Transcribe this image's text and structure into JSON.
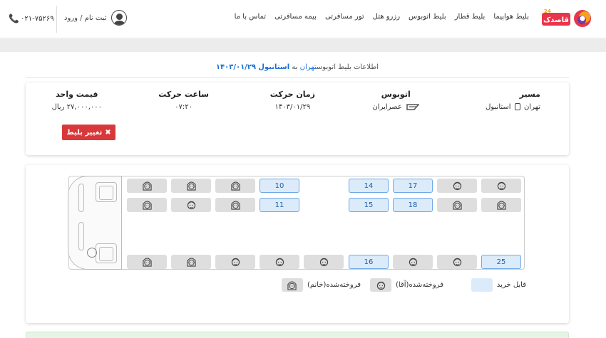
{
  "header": {
    "logo_text": "قاصدک",
    "logo_badge": "24",
    "nav": [
      "بلیط هواپیما",
      "بلیط قطار",
      "بلیط اتوبوس",
      "رزرو هتل",
      "تور مسافرتی",
      "بیمه مسافرتی",
      "تماس با ما"
    ],
    "login_label": "ثبت نام / ورود",
    "phone": "۰۲۱-۷۵۲۶۹"
  },
  "title": {
    "prefix": "اطلاعات بلیط اتوبوس",
    "from": "تهران",
    "mid": " به ",
    "to": "استانبول",
    "date": "۱۴۰۳/۰۱/۲۹"
  },
  "info": {
    "route_label": "مسیر",
    "route_from": "تهران",
    "route_to": "استانبول",
    "bus_label": "اتوبوس",
    "bus_company": "عصرایران",
    "date_label": "زمان حرکت",
    "date_value": "۱۴۰۳/۰۱/۲۹",
    "time_label": "ساعت حرکت",
    "time_value": "۰۷:۲۰",
    "price_label": "قیمت واحد",
    "price_value": "۲۷,۰۰۰,۰۰۰ ریال",
    "change_button": "تغییر بلیط"
  },
  "seats": {
    "row1": [
      "sold",
      "sold",
      "sold",
      "10",
      "",
      "14",
      "17",
      "sold",
      "sold"
    ],
    "row2": [
      "sold",
      "sold",
      "sold",
      "11",
      "",
      "15",
      "18",
      "sold",
      "sold"
    ],
    "row3": [
      "sold",
      "sold",
      "sold",
      "sold",
      "sold",
      "16",
      "sold",
      "sold",
      "25"
    ]
  },
  "legend": {
    "available": "قابل خرید",
    "sold_male": "فروخته‌شده(آقا)",
    "sold_female": "فروخته‌شده(خانم)"
  },
  "colors": {
    "accent": "#1a6fd6",
    "danger": "#d9383a",
    "seat_available": "#dcebfa",
    "seat_sold": "#dedede"
  }
}
